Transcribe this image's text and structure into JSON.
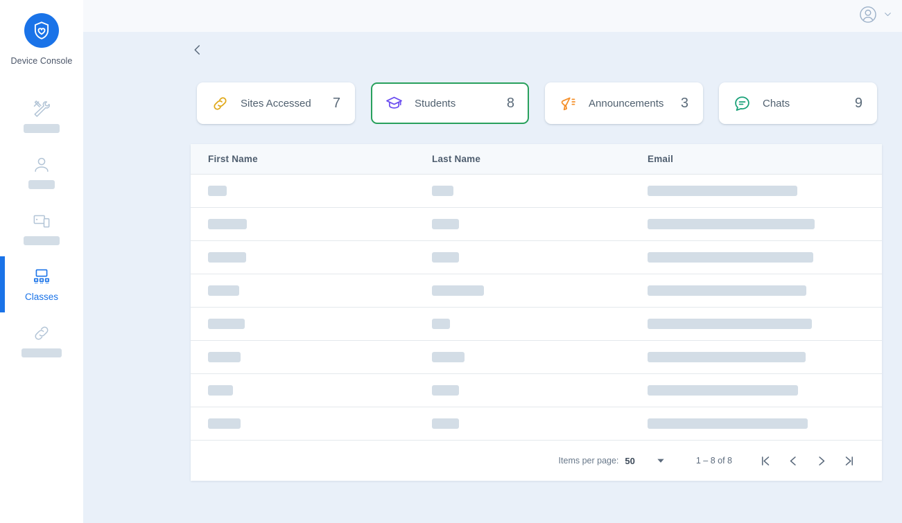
{
  "brand": {
    "label": "Device Console",
    "logo_icon": "shield-heart-icon",
    "logo_color": "#1a73e8"
  },
  "sidebar": {
    "active_color": "#1a73e8",
    "items": [
      {
        "icon": "tools-wrench-icon",
        "label": "",
        "loading": true,
        "skeleton_width": 52
      },
      {
        "icon": "person-icon",
        "label": "",
        "loading": true,
        "skeleton_width": 38
      },
      {
        "icon": "devices-icon",
        "label": "",
        "loading": true,
        "skeleton_width": 52
      },
      {
        "icon": "classroom-screen-icon",
        "label": "Classes",
        "loading": false,
        "active": true
      },
      {
        "icon": "link-chain-icon",
        "label": "",
        "loading": true,
        "skeleton_width": 58
      }
    ]
  },
  "topbar": {
    "avatar_icon": "user-avatar-icon",
    "caret_icon": "chevron-down-icon"
  },
  "backbar": {
    "back_icon": "chevron-left-icon"
  },
  "stats": [
    {
      "id": "sites-accessed",
      "label": "Sites Accessed",
      "count": "7",
      "icon": "link-chain-icon",
      "icon_color": "#e0a818",
      "selected": false
    },
    {
      "id": "students",
      "label": "Students",
      "count": "8",
      "icon": "graduation-cap-icon",
      "icon_color": "#6c4ff0",
      "selected": true
    },
    {
      "id": "announcements",
      "label": "Announcements",
      "count": "3",
      "icon": "megaphone-icon",
      "icon_color": "#f5902b",
      "selected": false
    },
    {
      "id": "chats",
      "label": "Chats",
      "count": "9",
      "icon": "chat-bubble-icon",
      "icon_color": "#17a077",
      "selected": false
    }
  ],
  "selected_border_color": "#28a05c",
  "table": {
    "columns": [
      "First Name",
      "Last Name",
      "Email"
    ],
    "loading": true,
    "rows": [
      {
        "first": 27,
        "last": 31,
        "email": 216
      },
      {
        "first": 56,
        "last": 39,
        "email": 241
      },
      {
        "first": 55,
        "last": 39,
        "email": 239
      },
      {
        "first": 45,
        "last": 75,
        "email": 229
      },
      {
        "first": 53,
        "last": 26,
        "email": 237
      },
      {
        "first": 47,
        "last": 47,
        "email": 228
      },
      {
        "first": 36,
        "last": 39,
        "email": 217
      },
      {
        "first": 47,
        "last": 39,
        "email": 231
      }
    ]
  },
  "paginator": {
    "items_per_page_label": "Items per page:",
    "items_per_page_value": "50",
    "range_label": "1 – 8 of 8",
    "first_icon": "first-page-icon",
    "prev_icon": "previous-page-icon",
    "next_icon": "next-page-icon",
    "last_icon": "last-page-icon"
  }
}
